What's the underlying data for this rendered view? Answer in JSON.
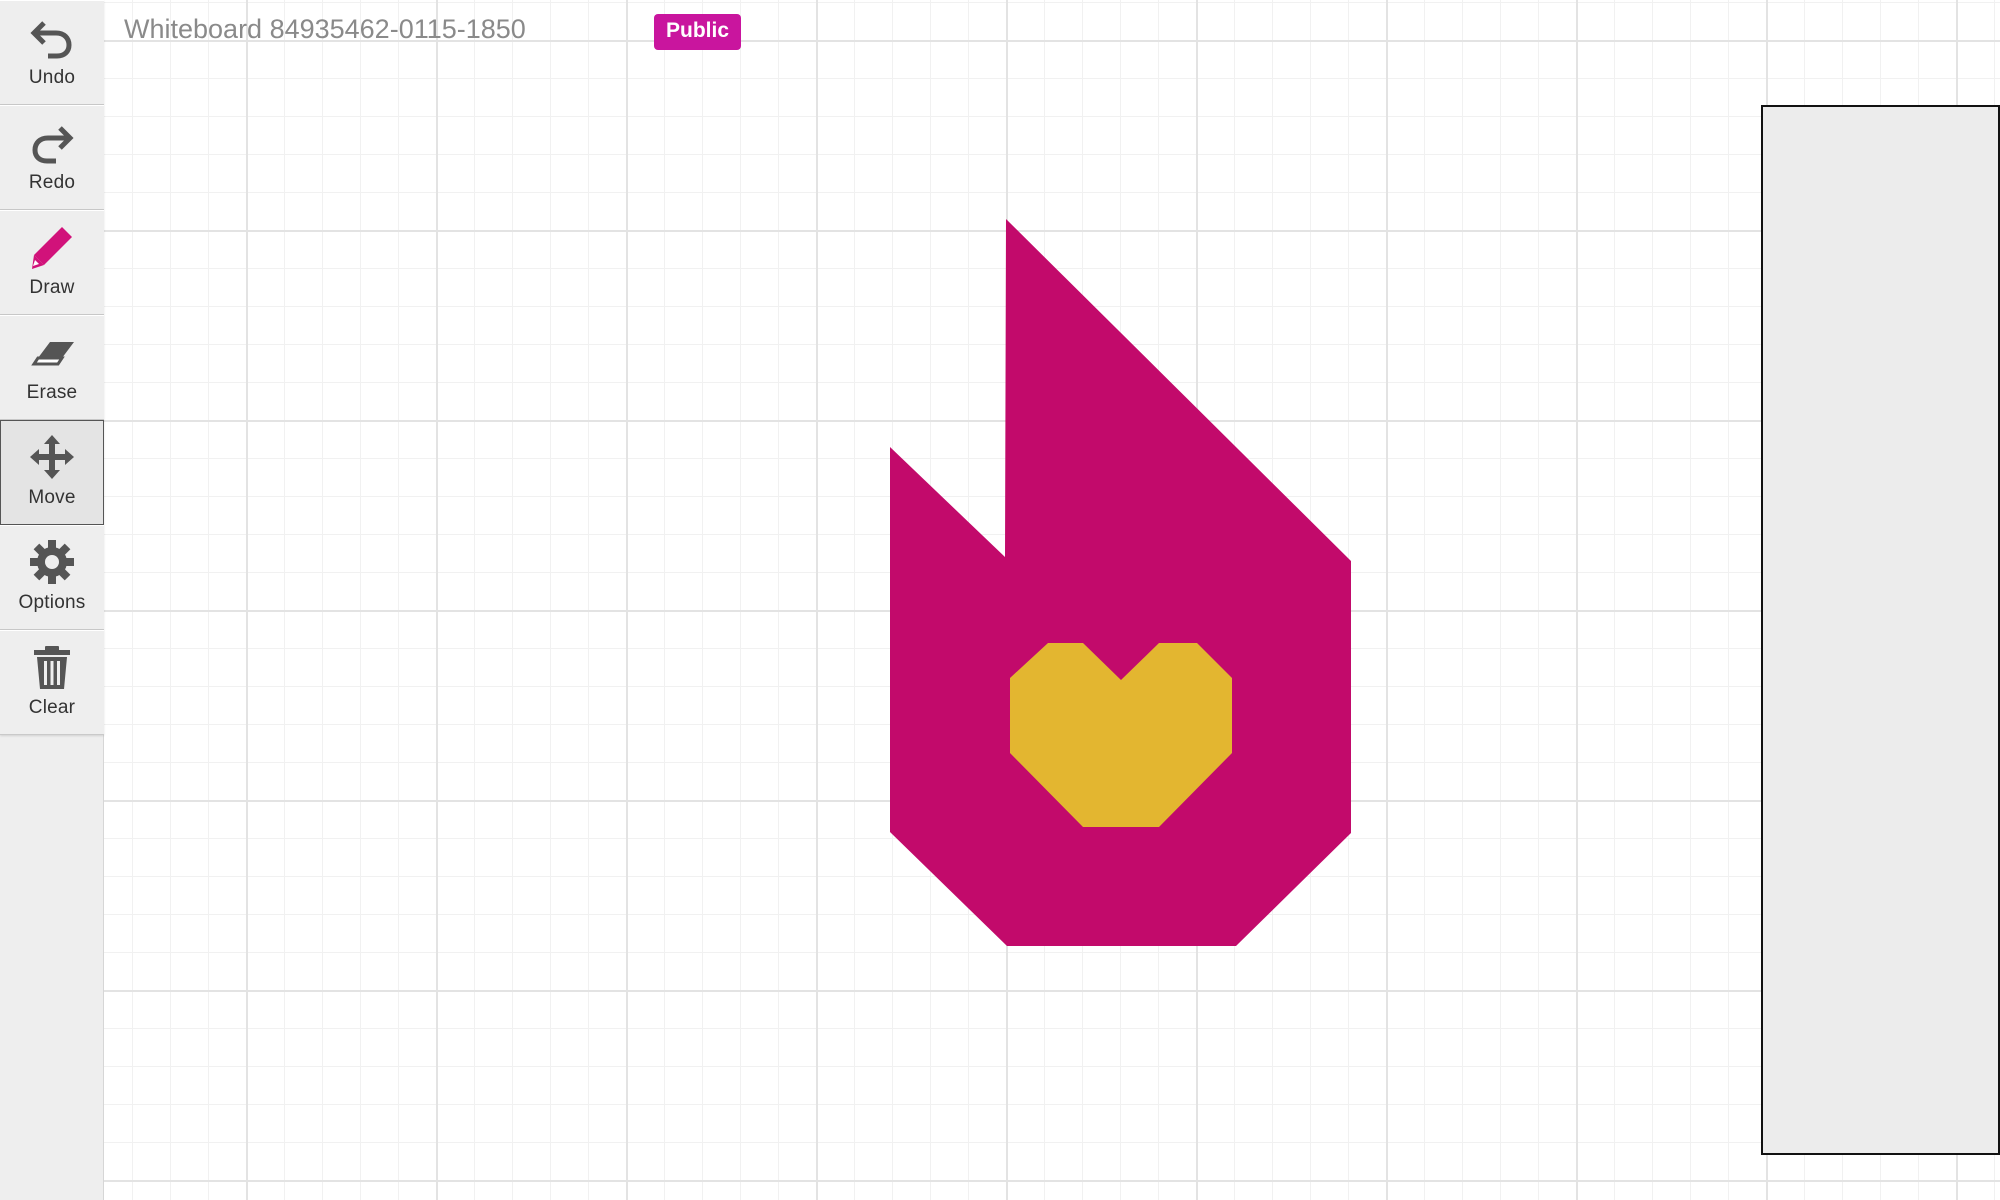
{
  "app": {
    "board_title": "Whiteboard 84935462-0115-1850",
    "visibility": "Public"
  },
  "toolbar": {
    "items": [
      {
        "label": "Undo",
        "icon": "undo-icon",
        "active": false
      },
      {
        "label": "Redo",
        "icon": "redo-icon",
        "active": false
      },
      {
        "label": "Draw",
        "icon": "pencil-icon",
        "active": false
      },
      {
        "label": "Erase",
        "icon": "eraser-icon",
        "active": false
      },
      {
        "label": "Move",
        "icon": "move-icon",
        "active": true
      },
      {
        "label": "Options",
        "icon": "gear-icon",
        "active": false
      },
      {
        "label": "Clear",
        "icon": "trash-icon",
        "active": false
      }
    ]
  },
  "canvas": {
    "shapes": [
      {
        "kind": "flame",
        "color": "#c20a6b"
      },
      {
        "kind": "heart",
        "color": "#e3b630"
      }
    ]
  },
  "colors": {
    "accent": "#c9159e",
    "pencil": "#d1127a",
    "icon": "#555555",
    "toolbar_bg": "#eeeeee",
    "panel_bg": "#ececec"
  }
}
